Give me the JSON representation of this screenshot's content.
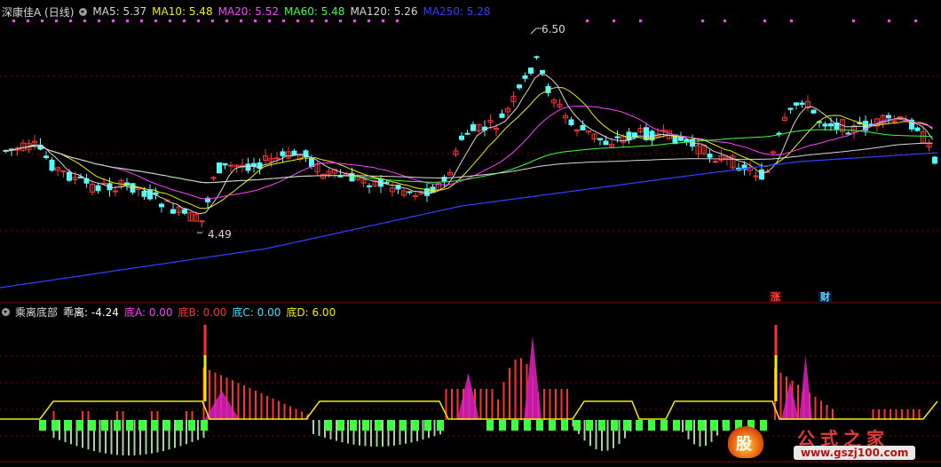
{
  "upper_panel": {
    "stock_title": "深康佳A (日线)",
    "indicators": [
      {
        "label": "MA5: 5.37",
        "color": "#d8d8d8"
      },
      {
        "label": "MA10: 5.48",
        "color": "#f0f000"
      },
      {
        "label": "MA20: 5.52",
        "color": "#ff40ff"
      },
      {
        "label": "MA60: 5.48",
        "color": "#40ff40"
      },
      {
        "label": "MA120: 5.26",
        "color": "#d8d8d8"
      },
      {
        "label": "MA250: 5.28",
        "color": "#3040ff"
      }
    ],
    "high_marker": "6.50",
    "low_marker": "4.49",
    "badge_zhang": "涨",
    "badge_cai": "财"
  },
  "lower_panel": {
    "indicator_name": "乘离底部",
    "values": [
      {
        "label": "乖离:",
        "value": "-4.24",
        "label_color": "#ffffff",
        "value_color": "#ffffff"
      },
      {
        "label": "底A:",
        "value": "0.00",
        "label_color": "#ff40ff",
        "value_color": "#ff40ff"
      },
      {
        "label": "底B:",
        "value": "0.00",
        "label_color": "#ff3030",
        "value_color": "#ff3030"
      },
      {
        "label": "底C:",
        "value": "0.00",
        "label_color": "#40e0ff",
        "value_color": "#40e0ff"
      },
      {
        "label": "底D:",
        "value": "6.00",
        "label_color": "#f0f000",
        "value_color": "#f0f000"
      }
    ]
  },
  "watermark": {
    "site_name": "公式之家",
    "url": "www.gszj100.com",
    "icon_glyph": "股"
  },
  "colors": {
    "up": "#ff3232",
    "down": "#54fcfc",
    "grid": "#7a0000",
    "marker": "#ff40ff"
  }
}
